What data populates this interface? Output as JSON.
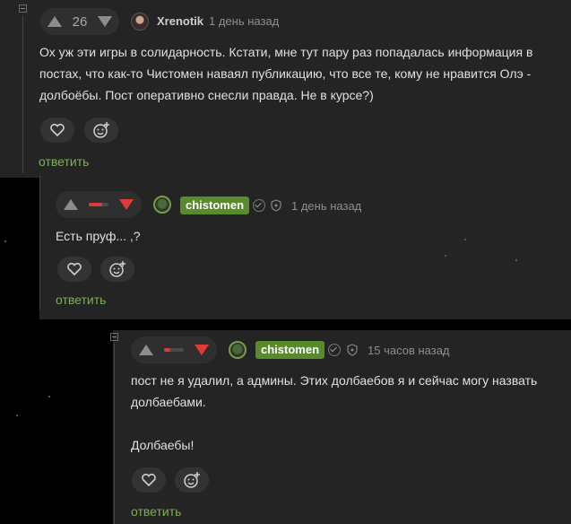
{
  "colors": {
    "accent_green": "#5a8a2e",
    "reply_green": "#7fae5a",
    "downvote_red": "#e03a3a",
    "panel": "#242424"
  },
  "comments": [
    {
      "score": "26",
      "username": "Xrenotik",
      "time": "1 день назад",
      "text": "Ох уж эти игры в солидарность. Кстати, мне тут пару раз попадалась информация в постах, что как-то Чистомен наваял публикацию, что все те, кому не нравится Олэ - долбоёбы. Пост оперативно снесли правда. Не в курсе?)",
      "reply_label": "ответить",
      "icons": [
        "heart-icon",
        "smiley-add-icon"
      ]
    },
    {
      "rating_fraction": 0.7,
      "username": "chistomen",
      "time": "1 день назад",
      "text": "Есть пруф... ,?",
      "reply_label": "ответить",
      "icons": [
        "heart-icon",
        "smiley-add-icon",
        "verified-check-icon",
        "shield-icon"
      ]
    },
    {
      "rating_fraction": 0.3,
      "username": "chistomen",
      "time": "15 часов назад",
      "text_line1": "пост не я удалил, а админы. Этих долбаебов я и сейчас могу назвать долбаебами.",
      "text_line2": "Долбаебы!",
      "reply_label": "ответить",
      "icons": [
        "heart-icon",
        "smiley-add-icon",
        "verified-check-icon",
        "shield-icon"
      ]
    }
  ]
}
